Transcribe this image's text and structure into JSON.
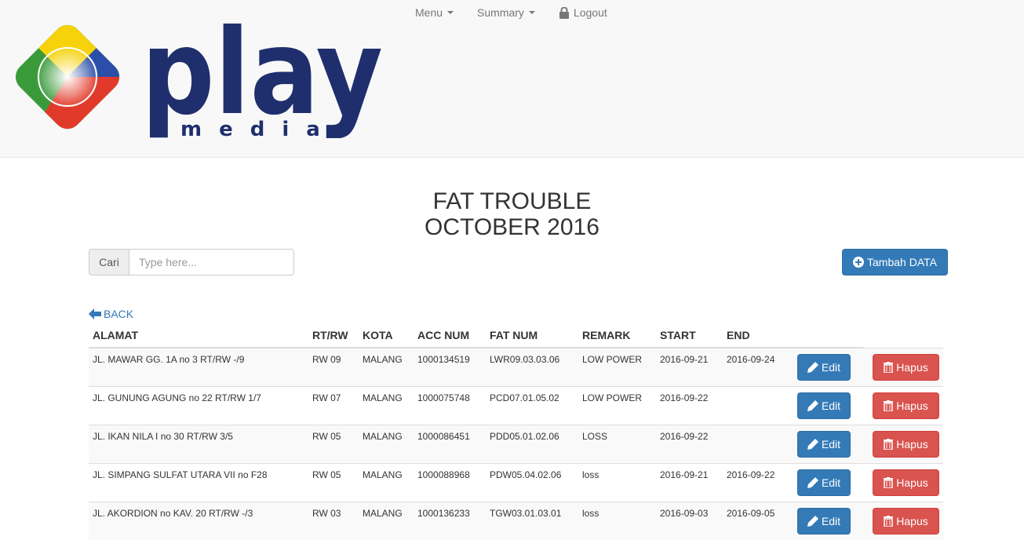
{
  "nav": {
    "menu_label": "Menu",
    "summary_label": "Summary",
    "logout_label": "Logout"
  },
  "logo": {
    "text": "play",
    "subtext": "media"
  },
  "page": {
    "title_line1": "FAT TROUBLE",
    "title_line2": "OCTOBER 2016"
  },
  "search": {
    "addon_label": "Cari",
    "placeholder": "Type here..."
  },
  "add_button_label": "Tambah DATA",
  "back_label": "BACK",
  "table": {
    "headers": [
      "ALAMAT",
      "RT/RW",
      "KOTA",
      "ACC NUM",
      "FAT NUM",
      "REMARK",
      "START",
      "END"
    ],
    "edit_label": "Edit",
    "delete_label": "Hapus",
    "rows": [
      [
        "JL. MAWAR GG. 1A no 3 RT/RW -/9",
        "RW 09",
        "MALANG",
        "1000134519",
        "LWR09.03.03.06",
        "LOW POWER",
        "2016-09-21",
        "2016-09-24"
      ],
      [
        "JL. GUNUNG AGUNG no 22 RT/RW 1/7",
        "RW 07",
        "MALANG",
        "1000075748",
        "PCD07.01.05.02",
        "LOW POWER",
        "2016-09-22",
        ""
      ],
      [
        "JL. IKAN NILA I no 30 RT/RW 3/5",
        "RW 05",
        "MALANG",
        "1000086451",
        "PDD05.01.02.06",
        "LOSS",
        "2016-09-22",
        ""
      ],
      [
        "JL. SIMPANG SULFAT UTARA VII no F28",
        "RW 05",
        "MALANG",
        "1000088968",
        "PDW05.04.02.06",
        "loss",
        "2016-09-21",
        "2016-09-22"
      ],
      [
        "JL. AKORDION no KAV. 20 RT/RW -/3",
        "RW 03",
        "MALANG",
        "1000136233",
        "TGW03.01.03.01",
        "loss",
        "2016-09-03",
        "2016-09-05"
      ]
    ]
  },
  "colors": {
    "primary": "#337ab7",
    "danger": "#d9534f",
    "logo_navy": "#1f2f6e",
    "logo_yellow": "#f5d20a",
    "logo_green": "#3a9a3a",
    "logo_red": "#e23a2a"
  }
}
